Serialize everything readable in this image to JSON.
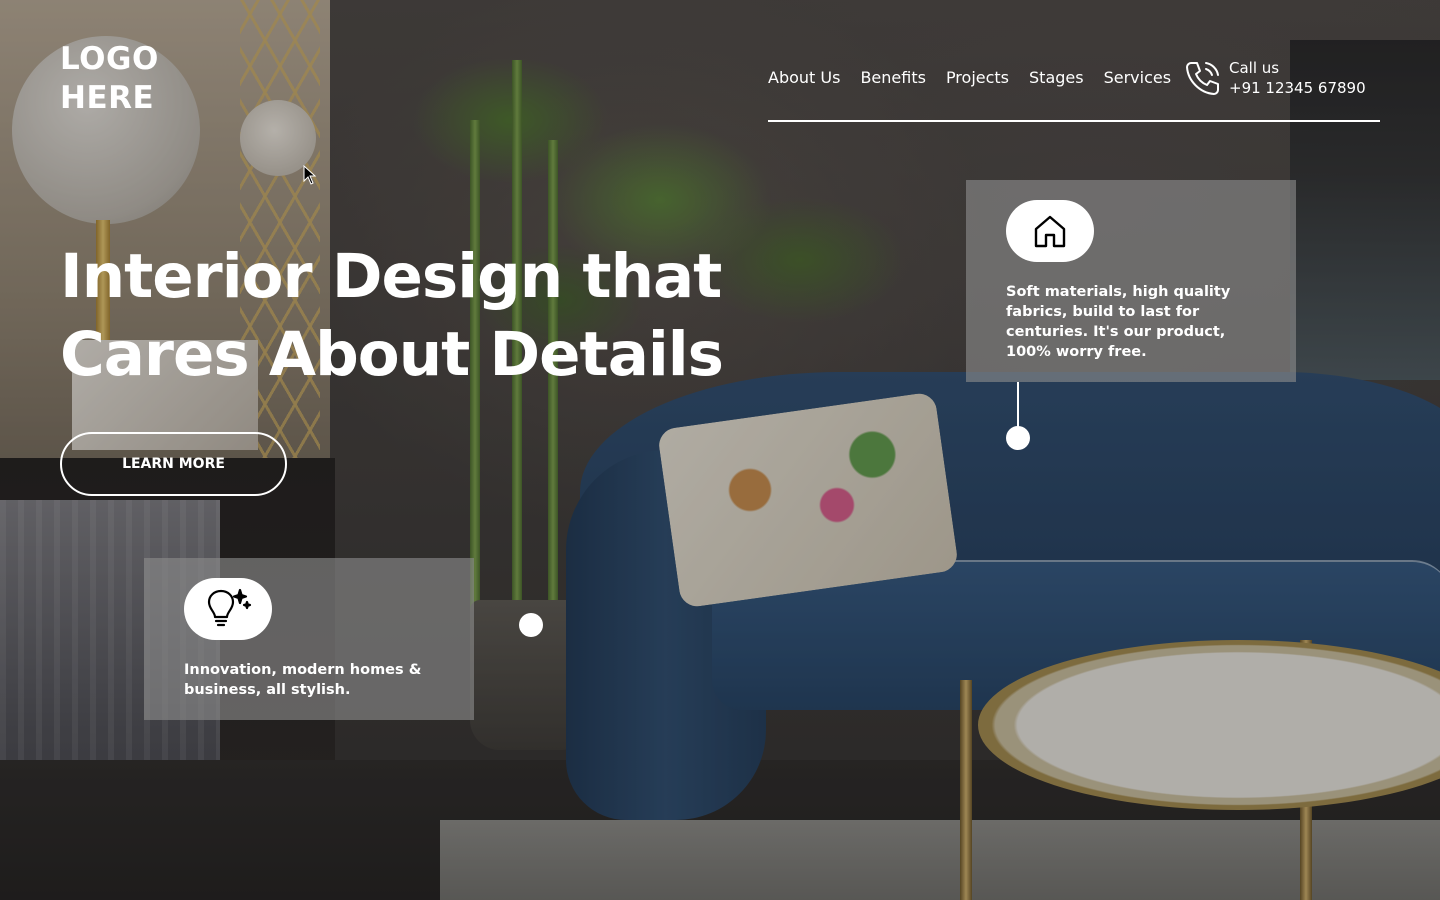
{
  "brand": {
    "logo_text": "LOGO\nHERE"
  },
  "nav": {
    "items": [
      {
        "label": "About Us"
      },
      {
        "label": "Benefits"
      },
      {
        "label": "Projects"
      },
      {
        "label": "Stages"
      },
      {
        "label": "Services"
      }
    ]
  },
  "contact": {
    "label": "Call us",
    "phone": "+91 12345 67890",
    "icon": "phone-icon"
  },
  "hero": {
    "title": "Interior Design that Cares About Details",
    "cta_label": "LEARN MORE"
  },
  "cards": [
    {
      "icon": "house-icon",
      "text": "Soft materials, high quality fabrics, build to last for centuries. It's our product, 100% worry free."
    },
    {
      "icon": "lightbulb-sparkle-icon",
      "text": "Innovation, modern homes & business, all stylish."
    }
  ],
  "colors": {
    "text": "#ffffff",
    "card_bg": "rgba(140,140,140,0.62)",
    "sofa": "#2b4a6e"
  }
}
